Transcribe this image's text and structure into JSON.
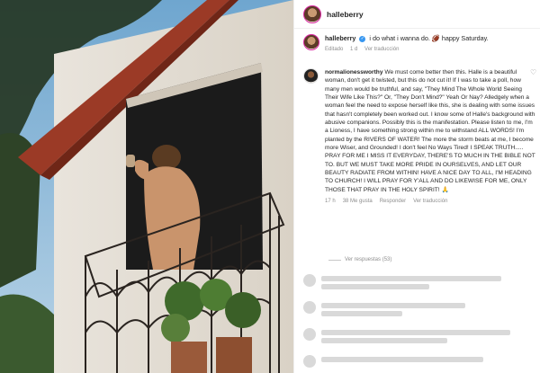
{
  "post": {
    "username": "halleberry",
    "caption_text": "i do what i wanna do. 🏈 happy Saturday.",
    "edited_label": "Editado",
    "time": "1 d",
    "see_translation": "Ver traducción"
  },
  "comment": {
    "username": "normalionessworthy",
    "text": "We must come better then this. Halle is a beautiful woman, don't get it twisted, but this do not cut it! If I was to take a poll, how many men would be truthful, and say, \"They Mind The Whole World Seeing Their Wife Like This?\" Or, \"They Don't Mind?\" Yeah Or Nay? Alledgely when a woman feel the need to expose herself like this, she is dealing with some issues that hasn't completely been worked out. I know some of Halle's background with abusive companions. Possibly this is the manifestation. Please listen to me, I'm a Lioness, I have something strong within me to withstand ALL WORDS! I'm planted by the RIVERS OF WATER! The more the storm beats at me, I become more Wiser, and Grounded! I don't feel No Ways Tired! I SPEAK TRUTH..... PRAY FOR ME I MISS IT EVERYDAY, THERE'S TO MUCH IN THE BIBLE NOT TO. BUT WE MUST TAKE MORE PRIDE IN OURSELVES, AND LET OUR BEAUTY RADIATE FROM WITHIN! HAVE A NICE DAY TO ALL, I'M HEADING TO CHURCH! I WILL PRAY FOR Y'ALL AND DO LIKEWISE FOR ME, ONLY THOSE THAT PRAY IN THE HOLY SPIRIT! 🙏",
    "time": "17 h",
    "likes": "38 Me gusta",
    "reply": "Responder",
    "see_translation": "Ver traducción",
    "view_replies": "Ver respuestas (53)"
  },
  "colors": {
    "verified": "#3897f0",
    "secondary_text": "#8e8e8e",
    "border": "#efefef"
  }
}
